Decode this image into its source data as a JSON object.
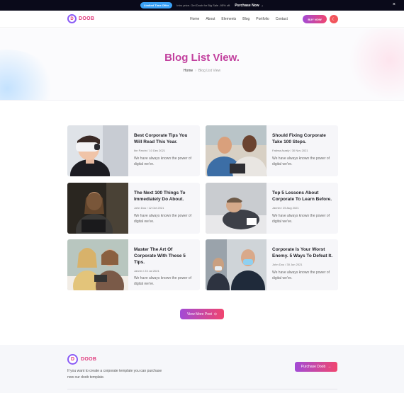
{
  "promo": {
    "badge": "Limited Time Offer",
    "text": "Intro price. Get Doob for Big Sale -95% off.",
    "link": "Purchase Now",
    "link_arrow": "→",
    "close": "×"
  },
  "header": {
    "logo_mark": "D",
    "logo_text": "DOOB",
    "nav": [
      "Home",
      "About",
      "Elements",
      "Blog",
      "Portfolio",
      "Contact"
    ],
    "buy_label": "BUY NOW",
    "theme_icon": "☾"
  },
  "hero": {
    "title": "Blog List View.",
    "breadcrumb_home": "Home",
    "breadcrumb_sep": "›",
    "breadcrumb_current": "Blog List View"
  },
  "posts": [
    {
      "title": "Best Corporate Tips You Will Read This Year.",
      "author": "Ibn Parvin",
      "date": "10 Dec 2021",
      "excerpt": "We have always known the power of digital we've."
    },
    {
      "title": "Should Fixing Corporate Take 100 Steps.",
      "author": "Fatima Asrafy",
      "date": "30 Nov 2021",
      "excerpt": "We have always known the power of digital we've."
    },
    {
      "title": "The Next 100 Things To Immediately Do About.",
      "author": "John Dou",
      "date": "12 Oct 2021",
      "excerpt": "We have always known the power of digital we've."
    },
    {
      "title": "Top 5 Lessons About Corporate To Learn Before.",
      "author": "Jannin",
      "date": "25 Aug 2021",
      "excerpt": "We have always known the power of digital we've."
    },
    {
      "title": "Master The Art Of Corporate With These 5 Tips.",
      "author": "Jannin",
      "date": "23 Jul 2021",
      "excerpt": "We have always known the power of digital we've."
    },
    {
      "title": "Corporate Is Your Worst Enemy. 5 Ways To Defeat It.",
      "author": "John Dou",
      "date": "30 Jun 2021",
      "excerpt": "We have always known the power of digital we've."
    }
  ],
  "meta_separator": "/",
  "more_button": {
    "label": "View More Post",
    "icon": "⊙"
  },
  "footer": {
    "logo_mark": "D",
    "logo_text": "DOOB",
    "text": "If you want to create a corporate template you can purchase now our doob template.",
    "purchase_label": "Purchase Doob",
    "purchase_arrow": "→"
  },
  "colors": {
    "brand_gradient_start": "#a24bd6",
    "brand_gradient_end": "#f0456f",
    "hero_title": "#c2409e"
  }
}
